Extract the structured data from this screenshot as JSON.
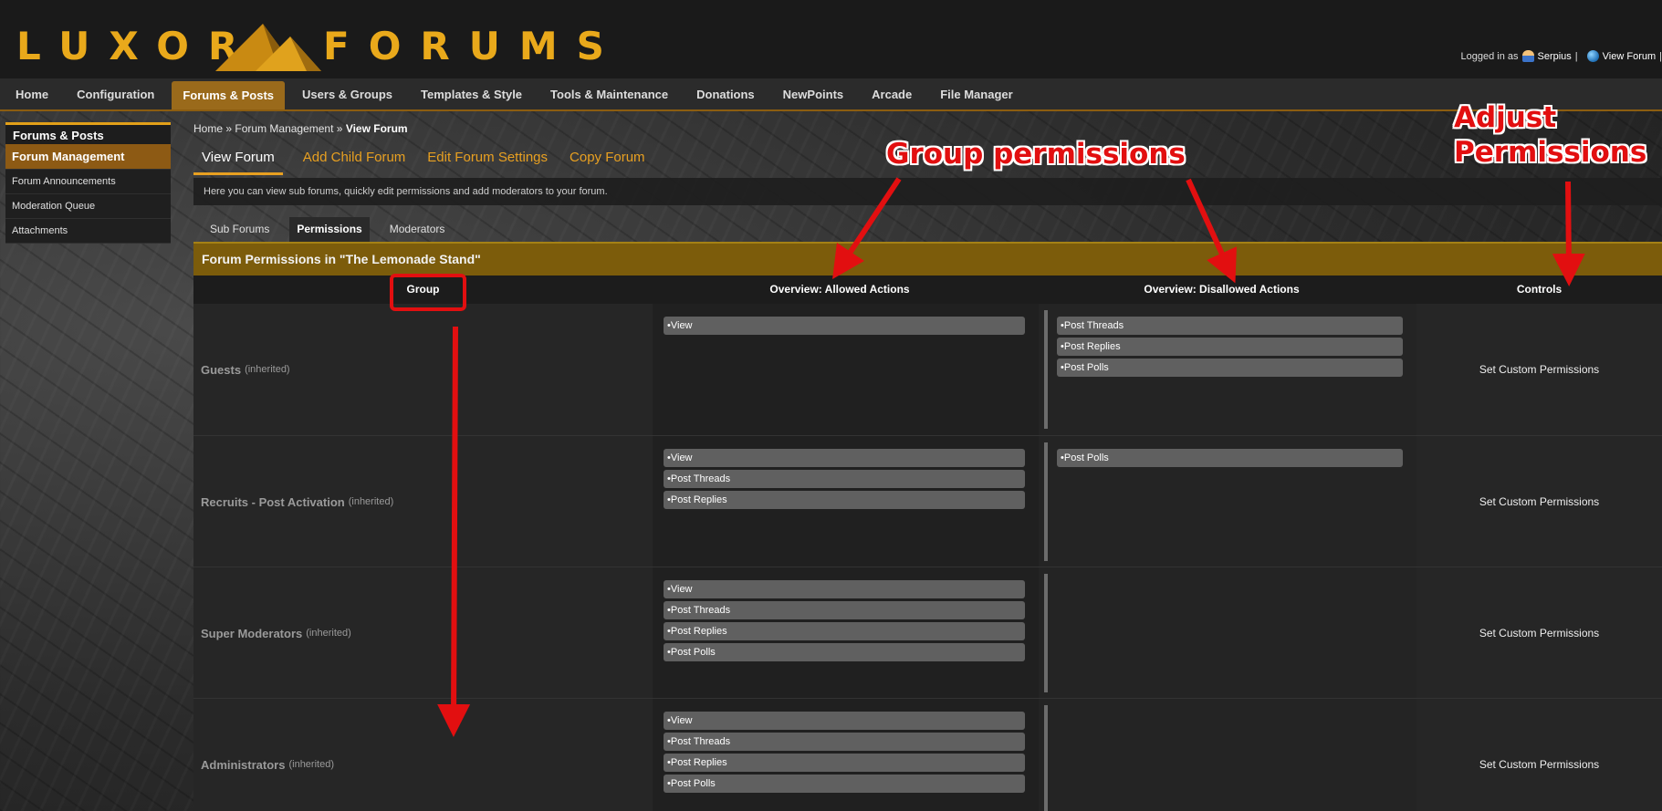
{
  "logo": {
    "word1": "LUXOR",
    "word2": "FORUMS"
  },
  "userbar": {
    "prefix": "Logged in as",
    "username": "Serpius",
    "separator1": "|",
    "view_forum": "View Forum",
    "separator2": "|"
  },
  "topnav": [
    {
      "label": "Home"
    },
    {
      "label": "Configuration"
    },
    {
      "label": "Forums & Posts",
      "active": true
    },
    {
      "label": "Users & Groups"
    },
    {
      "label": "Templates & Style"
    },
    {
      "label": "Tools & Maintenance"
    },
    {
      "label": "Donations"
    },
    {
      "label": "NewPoints"
    },
    {
      "label": "Arcade"
    },
    {
      "label": "File Manager"
    }
  ],
  "sidebar": {
    "title": "Forums & Posts",
    "items": [
      {
        "label": "Forum Management",
        "active": true
      },
      {
        "label": "Forum Announcements"
      },
      {
        "label": "Moderation Queue"
      },
      {
        "label": "Attachments"
      }
    ]
  },
  "breadcrumb": {
    "home": "Home",
    "sep1": "»",
    "mgmt": "Forum Management",
    "sep2": "»",
    "current": "View Forum"
  },
  "tabs": [
    {
      "label": "View Forum",
      "active": true
    },
    {
      "label": "Add Child Forum"
    },
    {
      "label": "Edit Forum Settings"
    },
    {
      "label": "Copy Forum"
    }
  ],
  "intro": "Here you can view sub forums, quickly edit permissions and add moderators to your forum.",
  "subtabs": [
    {
      "label": "Sub Forums"
    },
    {
      "label": "Permissions",
      "active": true
    },
    {
      "label": "Moderators"
    }
  ],
  "panel": {
    "title": "Forum Permissions in \"The Lemonade Stand\"",
    "headers": {
      "group": "Group",
      "allowed": "Overview: Allowed Actions",
      "disallowed": "Overview: Disallowed Actions",
      "controls": "Controls"
    },
    "rows": [
      {
        "group": "Guests",
        "note": "(inherited)",
        "allowed": [
          "View"
        ],
        "disallowed": [
          "Post Threads",
          "Post Replies",
          "Post Polls"
        ],
        "control": "Set Custom Permissions"
      },
      {
        "group": "Recruits - Post Activation",
        "note": "(inherited)",
        "allowed": [
          "View",
          "Post Threads",
          "Post Replies"
        ],
        "disallowed": [
          "Post Polls"
        ],
        "control": "Set Custom Permissions"
      },
      {
        "group": "Super Moderators",
        "note": "(inherited)",
        "allowed": [
          "View",
          "Post Threads",
          "Post Replies",
          "Post Polls"
        ],
        "disallowed": [],
        "control": "Set Custom Permissions"
      },
      {
        "group": "Administrators",
        "note": "(inherited)",
        "allowed": [
          "View",
          "Post Threads",
          "Post Replies",
          "Post Polls"
        ],
        "disallowed": [],
        "control": "Set Custom Permissions"
      }
    ]
  },
  "annotations": {
    "group_permissions": "Group permissions",
    "adjust_line1": "Adjust",
    "adjust_line2": "Permissions"
  },
  "colors": {
    "accent": "#e9a91b",
    "active_tab_bg": "#9a6a1b",
    "panel_title_bg": "#7c5c0b",
    "annotation_red": "#e20f10",
    "chip_bg": "#606060"
  }
}
